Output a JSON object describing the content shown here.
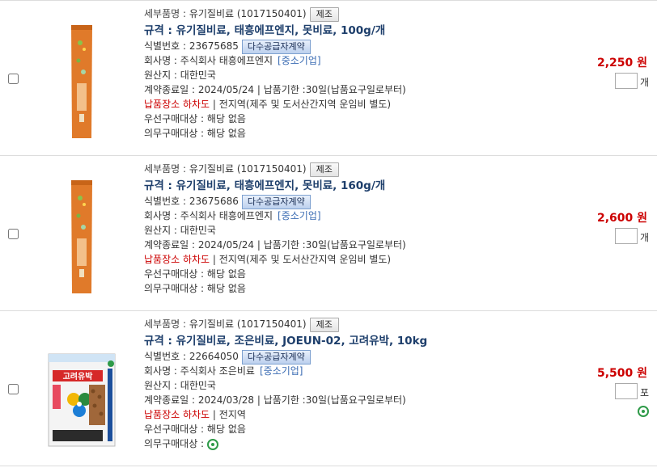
{
  "items": [
    {
      "detail_label": "세부품명 : ",
      "detail_value": "유기질비료 (1017150401)",
      "jejo_label": "제조",
      "spec": "규격 : 유기질비료, 태흥에프엔지, 못비료, 100g/개",
      "id_label": "식별번호 : ",
      "id_value": "23675685",
      "multi_label": "다수공급자계약",
      "company_label": "회사명 : ",
      "company_value": "주식회사 태흥에프엔지",
      "sme_label": "[중소기업]",
      "origin_label": "원산지 : ",
      "origin_value": "대한민국",
      "contract_text": "계약종료일 : 2024/05/24 | 납품기한 :30일(납품요구일로부터)",
      "delivery_label": "납품장소 하차도",
      "delivery_value": " | 전지역(제주 및 도서산간지역 운임비 별도)",
      "priority_label": "우선구매대상 : ",
      "priority_value": "해당 없음",
      "mandatory_label": "의무구매대상 : ",
      "mandatory_value": "해당 없음",
      "price": "2,250 원",
      "unit": "개",
      "image": "orange-fertilizer-bag-icon"
    },
    {
      "detail_label": "세부품명 : ",
      "detail_value": "유기질비료 (1017150401)",
      "jejo_label": "제조",
      "spec": "규격 : 유기질비료, 태흥에프엔지, 못비료, 160g/개",
      "id_label": "식별번호 : ",
      "id_value": "23675686",
      "multi_label": "다수공급자계약",
      "company_label": "회사명 : ",
      "company_value": "주식회사 태흥에프엔지",
      "sme_label": "[중소기업]",
      "origin_label": "원산지 : ",
      "origin_value": "대한민국",
      "contract_text": "계약종료일 : 2024/05/24 | 납품기한 :30일(납품요구일로부터)",
      "delivery_label": "납품장소 하차도",
      "delivery_value": " | 전지역(제주 및 도서산간지역 운임비 별도)",
      "priority_label": "우선구매대상 : ",
      "priority_value": "해당 없음",
      "mandatory_label": "의무구매대상 : ",
      "mandatory_value": "해당 없음",
      "price": "2,600 원",
      "unit": "개",
      "image": "orange-fertilizer-bag-icon"
    },
    {
      "detail_label": "세부품명 : ",
      "detail_value": "유기질비료 (1017150401)",
      "jejo_label": "제조",
      "spec": "규격 : 유기질비료, 조은비료, JOEUN-02, 고려유박, 10kg",
      "id_label": "식별번호 : ",
      "id_value": "22664050",
      "multi_label": "다수공급자계약",
      "company_label": "회사명 : ",
      "company_value": "주식회사 조은비료",
      "sme_label": "[중소기업]",
      "origin_label": "원산지 : ",
      "origin_value": "대한민국",
      "contract_text": "계약종료일 : 2024/03/28 | 납품기한 :30일(납품요구일로부터)",
      "delivery_label": "납품장소 하차도",
      "delivery_value": " | 전지역",
      "priority_label": "우선구매대상 : ",
      "priority_value": "해당 없음",
      "mandatory_label": "의무구매대상 : ",
      "mandatory_value": "",
      "price": "5,500 원",
      "unit": "포",
      "image": "goryeo-yubak-bag-icon",
      "bag_text": "고려유박"
    }
  ],
  "colors": {
    "price": "#c00000",
    "title": "#1d3e6b",
    "sme": "#3b6cb3",
    "eco_mark": "#2e9a48"
  }
}
